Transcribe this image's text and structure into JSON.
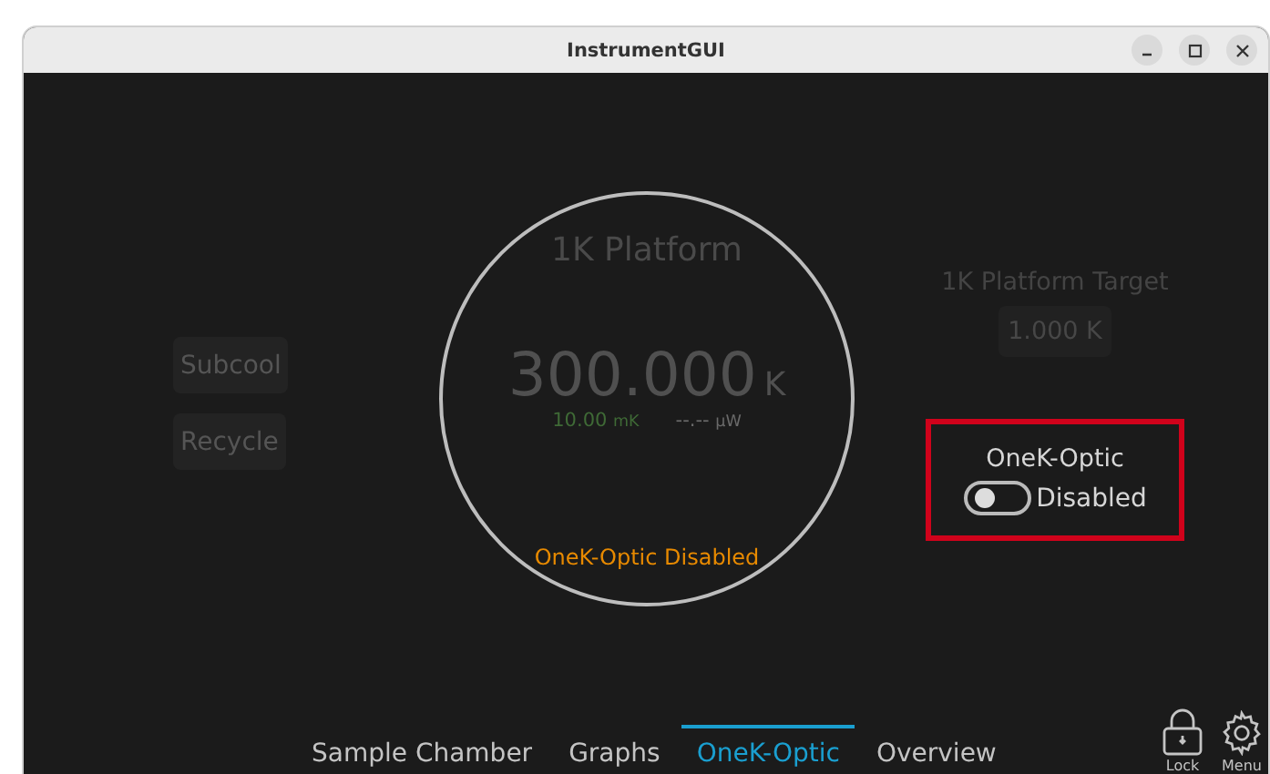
{
  "window": {
    "title": "InstrumentGUI"
  },
  "side_buttons": [
    {
      "label": "Subcool"
    },
    {
      "label": "Recycle"
    }
  ],
  "platform": {
    "title": "1K Platform",
    "value": "300.000",
    "unit": "K",
    "readings": [
      {
        "value": "10.00",
        "unit": "mK",
        "color": "#3f6a36"
      },
      {
        "value": "--.--",
        "unit": "µW",
        "color": "#6a6a6a"
      }
    ],
    "status": "OneK-Optic Disabled"
  },
  "target": {
    "label": "1K Platform Target",
    "value": "1.000 K"
  },
  "optic": {
    "title": "OneK-Optic",
    "on": false,
    "state_label": "Disabled"
  },
  "tabs": [
    {
      "label": "Sample Chamber",
      "selected": false
    },
    {
      "label": "Graphs",
      "selected": false
    },
    {
      "label": "OneK-Optic",
      "selected": true
    },
    {
      "label": "Overview",
      "selected": false
    }
  ],
  "tools": [
    {
      "kind": "lock",
      "label": "Lock"
    },
    {
      "kind": "menu",
      "label": "Menu"
    }
  ]
}
